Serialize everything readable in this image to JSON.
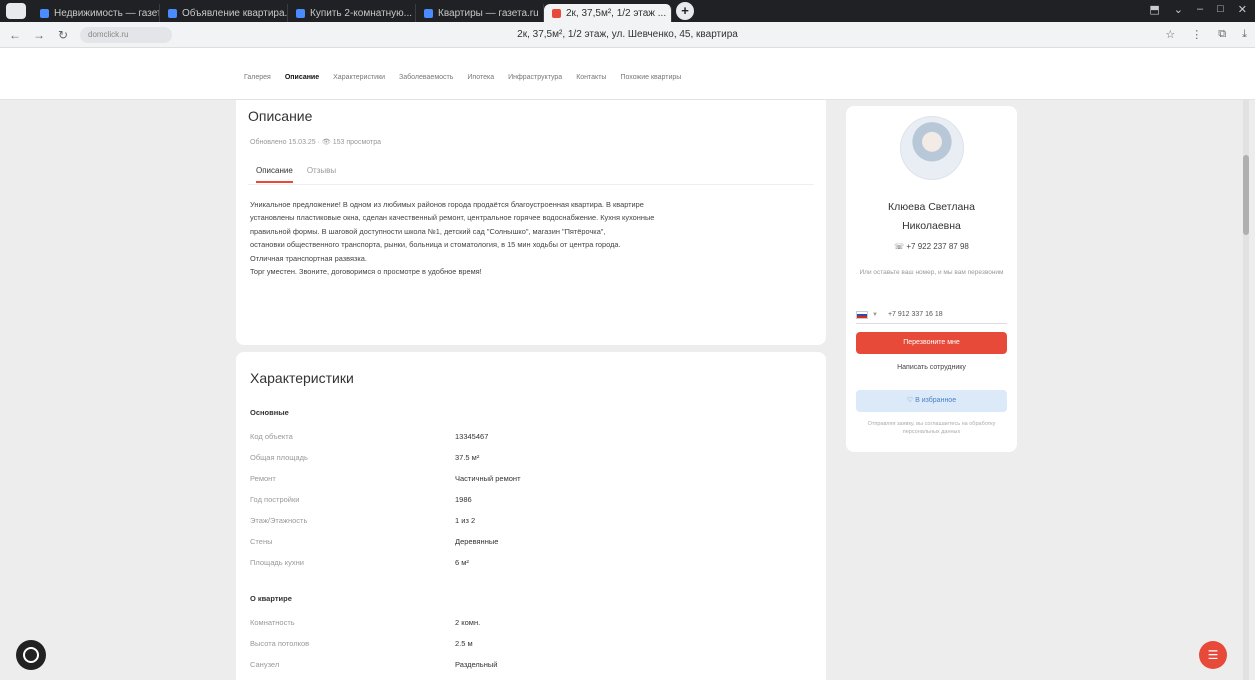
{
  "browser": {
    "tabs": [
      {
        "label": "Недвижимость — газета.ru",
        "active": false
      },
      {
        "label": "Объявление квартира...",
        "active": false
      },
      {
        "label": "Купить 2-комнатную...",
        "active": false
      },
      {
        "label": "Квартиры — газета.ru",
        "active": false
      },
      {
        "label": "2к, 37,5м², 1/2 этаж ...",
        "active": true
      }
    ],
    "new_tab": "+",
    "window_controls": [
      "⬒",
      "⌄",
      "–",
      "□",
      "✕"
    ],
    "url_chip": "domclick.ru",
    "page_title": "2к, 37,5м², 1/2 этаж, ул. Шевченко, 45, квартира",
    "right_icons": [
      "☆",
      "⋮",
      "⧉",
      "⤓"
    ]
  },
  "site_nav": {
    "items": [
      {
        "label": "Галерея",
        "active": false
      },
      {
        "label": "Описание",
        "active": true
      },
      {
        "label": "Характеристики",
        "active": false
      },
      {
        "label": "Заболеваемость",
        "active": false
      },
      {
        "label": "Ипотека",
        "active": false
      },
      {
        "label": "Инфраструктура",
        "active": false
      },
      {
        "label": "Контакты",
        "active": false
      },
      {
        "label": "Похожие квартиры",
        "active": false
      }
    ]
  },
  "description": {
    "title": "Описание",
    "meta": "Обновлено 15.03.25 · 👁 153 просмотра",
    "tabs": [
      {
        "label": "Описание",
        "active": true
      },
      {
        "label": "Отзывы",
        "active": false
      }
    ],
    "lines": [
      "Уникальное предложение! В одном из любимых районов города продаётся благоустроенная квартира. В квартире",
      "установлены пластиковые окна, сделан качественный ремонт, центральное горячее водоснабжение. Кухня кухонные",
      "правильной формы. В шаговой доступности школа №1, детский сад \"Солнышко\", магазин \"Пятёрочка\",",
      "остановки общественного транспорта, рынки, больница и стоматология, в 15 мин ходьбы от центра города.",
      "Отличная транспортная развязка.",
      "Торг уместен. Звоните, договоримся о просмотре в удобное время!"
    ]
  },
  "characteristics": {
    "title": "Характеристики",
    "sections": [
      {
        "title": "Основные",
        "rows": [
          {
            "key": "Код объекта",
            "value": "13345467"
          },
          {
            "key": "Общая площадь",
            "value": "37.5 м²"
          },
          {
            "key": "Ремонт",
            "value": "Частичный ремонт"
          },
          {
            "key": "Год постройки",
            "value": "1986"
          },
          {
            "key": "Этаж/Этажность",
            "value": "1 из 2"
          },
          {
            "key": "Стены",
            "value": "Деревянные"
          },
          {
            "key": "Площадь кухни",
            "value": "6 м²"
          }
        ]
      },
      {
        "title": "О квартире",
        "rows": [
          {
            "key": "Комнатность",
            "value": "2 комн."
          },
          {
            "key": "Высота потолков",
            "value": "2.5 м"
          },
          {
            "key": "Санузел",
            "value": "Раздельный"
          }
        ]
      }
    ]
  },
  "agent": {
    "name_line1": "Клюева Светлана",
    "name_line2": "Николаевна",
    "phone": "+7 922 237 87 98",
    "note": "Или оставьте ваш номер, и мы вам перезвоним",
    "input_value": "+7 912 337 16 18",
    "call_me_label": "Перезвоните мне",
    "write_label": "Написать сотруднику",
    "favorite_label": "В избранное",
    "footer_note": "Отправляя заявку, вы соглашаетесь на обработку персональных данных"
  },
  "colors": {
    "accent": "#e84a3a",
    "blue_button_bg": "#dbe9f8",
    "page_bg": "#ededed"
  }
}
